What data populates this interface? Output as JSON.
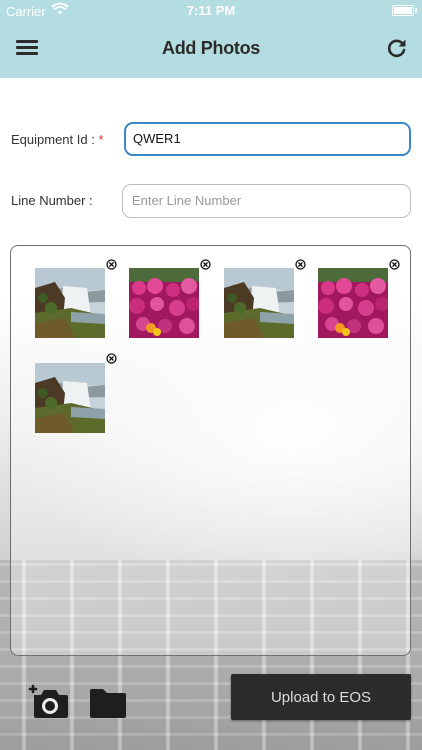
{
  "status_bar": {
    "carrier": "Carrier",
    "time": "7:11 PM"
  },
  "nav": {
    "title": "Add Photos",
    "menu_icon": "hamburger-menu-icon",
    "refresh_icon": "refresh-icon"
  },
  "form": {
    "equipment_id_label": "Equipment Id  : ",
    "required_marker": "*",
    "equipment_id_value": "QWER1",
    "line_number_label": "Line Number :",
    "line_number_placeholder": "Enter Line Number",
    "line_number_value": ""
  },
  "photos": [
    {
      "subject": "waterfall"
    },
    {
      "subject": "flowers"
    },
    {
      "subject": "waterfall"
    },
    {
      "subject": "flowers"
    },
    {
      "subject": "waterfall"
    }
  ],
  "actions": {
    "camera_icon": "add-camera-icon",
    "folder_icon": "folder-icon",
    "upload_label": "Upload to EOS"
  },
  "colors": {
    "header_bg": "#b4dde2",
    "focus_border": "#3b87c8",
    "required": "#e0342f",
    "upload_bg": "#2b2b2b"
  }
}
